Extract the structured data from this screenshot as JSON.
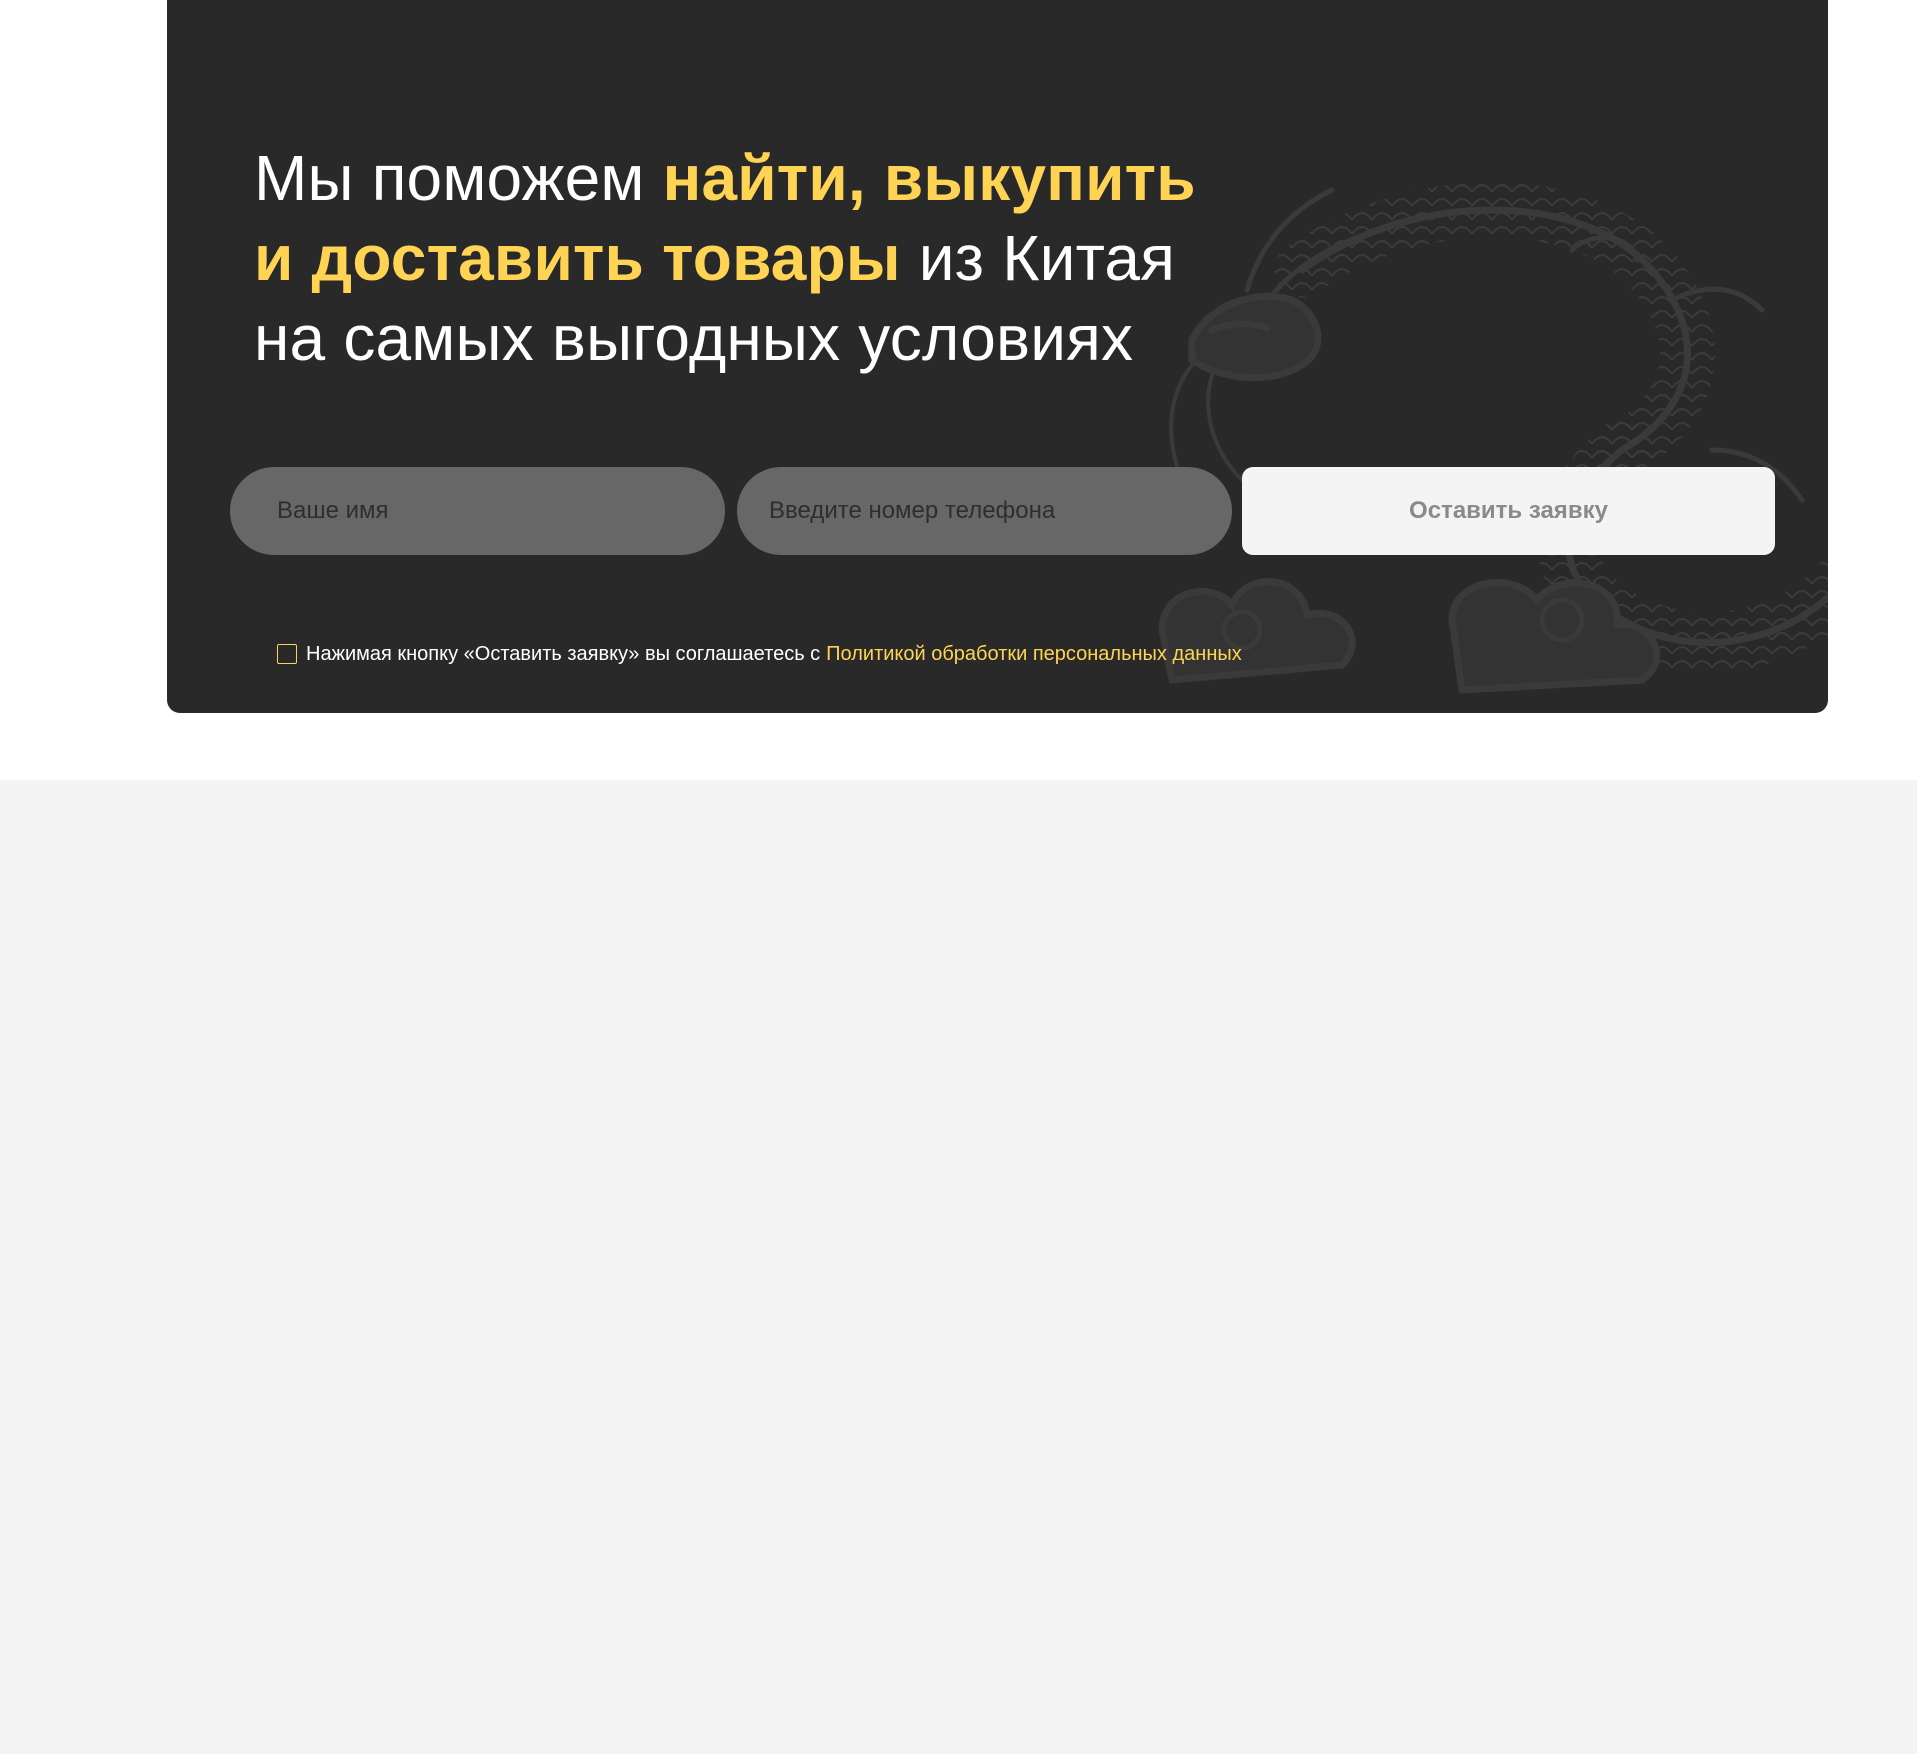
{
  "hero": {
    "headline": {
      "part1": "Мы поможем ",
      "highlight1": "найти, выкупить",
      "highlight2": "и доставить товары",
      "part2": " из Китая",
      "part3": "на самых выгодных условиях"
    },
    "form": {
      "name_placeholder": "Ваше имя",
      "phone_placeholder": "Введите номер телефона",
      "submit_label": "Оставить заявку"
    },
    "consent": {
      "text": "Нажимая кнопку «Оставить заявку» вы соглашаетесь с",
      "link_text": "Политикой обработки персональных данных",
      "checked": false
    },
    "decor_icon": "dragon-illustration"
  },
  "colors": {
    "card_background": "#292929",
    "accent": "#ffd455",
    "input_background": "#676767",
    "button_background": "#f4f4f4",
    "button_text": "#8a8a8a",
    "page_lower_background": "#f4f4f4"
  }
}
